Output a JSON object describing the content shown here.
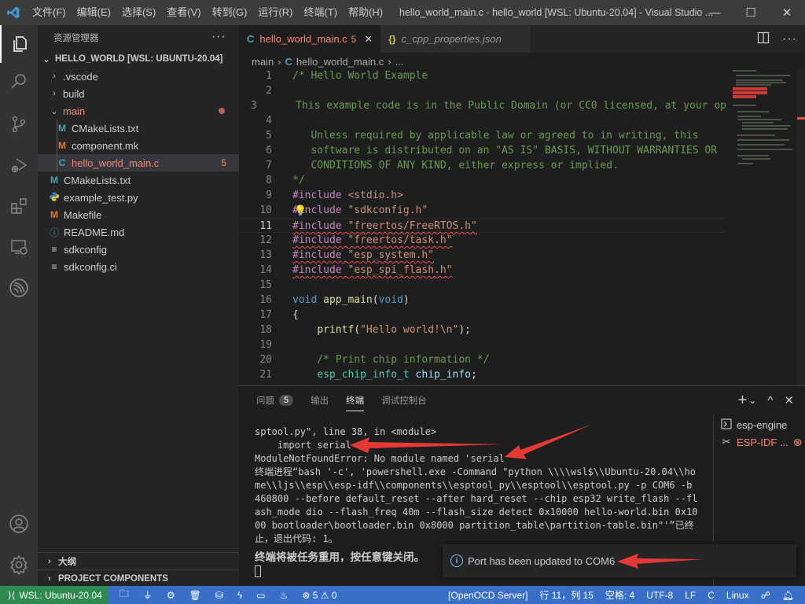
{
  "window": {
    "title": "hello_world_main.c - hello_world [WSL: Ubuntu-20.04] - Visual Studio ...",
    "menu": [
      "文件(F)",
      "编辑(E)",
      "选择(S)",
      "查看(V)",
      "转到(G)",
      "运行(R)",
      "终端(T)",
      "帮助(H)"
    ],
    "controls": {
      "minimize": "—",
      "maximize": "☐",
      "close": "✕"
    }
  },
  "activity_bar": {
    "items": [
      "explorer-icon",
      "search-icon",
      "source-control-icon",
      "run-debug-icon",
      "extensions-icon",
      "remote-explorer-icon",
      "espressif-icon"
    ],
    "bottom": [
      "account-icon",
      "settings-gear-icon"
    ]
  },
  "sidebar": {
    "title": "资源管理器",
    "more": "···",
    "root": "HELLO_WORLD [WSL: UBUNTU-20.04]",
    "tree": [
      {
        "label": ".vscode",
        "type": "folder",
        "expanded": false
      },
      {
        "label": "build",
        "type": "folder",
        "expanded": false
      },
      {
        "label": "main",
        "type": "folder",
        "expanded": true,
        "modified": true
      },
      {
        "label": "CMakeLists.txt",
        "icon": "M",
        "icon_color": "#519aba"
      },
      {
        "label": "component.mk",
        "icon": "M",
        "icon_color": "#e37933"
      },
      {
        "label": "hello_world_main.c",
        "icon": "C",
        "icon_color": "#519aba",
        "problems": "5"
      },
      {
        "label": "CMakeLists.txt",
        "icon": "M",
        "icon_color": "#519aba"
      },
      {
        "label": "example_test.py",
        "icon": "py",
        "icon_color": "#519aba"
      },
      {
        "label": "Makefile",
        "icon": "M",
        "icon_color": "#e37933"
      },
      {
        "label": "README.md",
        "icon": "ⓘ",
        "icon_color": "#519aba"
      },
      {
        "label": "sdkconfig",
        "icon": "≡",
        "icon_color": "#cccccc"
      },
      {
        "label": "sdkconfig.ci",
        "icon": "≡",
        "icon_color": "#cccccc"
      }
    ],
    "sections": [
      "大纲",
      "PROJECT COMPONENTS"
    ]
  },
  "editor": {
    "tabs": [
      {
        "icon": "C",
        "label": "hello_world_main.c",
        "problems": "5",
        "close": "✕",
        "active": true
      },
      {
        "icon": "{}",
        "label": "c_cpp_properties.json",
        "active": false
      }
    ],
    "breadcrumb": [
      "main",
      "hello_world_main.c",
      "..."
    ],
    "current_line": 11,
    "lines": [
      {
        "n": "1",
        "text": "/* Hello World Example"
      },
      {
        "n": "2",
        "text": ""
      },
      {
        "n": "3",
        "text": "   This example code is in the Public Domain (or CC0 licensed, at your op"
      },
      {
        "n": "4",
        "text": ""
      },
      {
        "n": "5",
        "text": "   Unless required by applicable law or agreed to in writing, this"
      },
      {
        "n": "6",
        "text": "   software is distributed on an \"AS IS\" BASIS, WITHOUT WARRANTIES OR"
      },
      {
        "n": "7",
        "text": "   CONDITIONS OF ANY KIND, either express or implied."
      },
      {
        "n": "8",
        "text": "*/"
      },
      {
        "n": "9",
        "pp": "#include",
        "arg": "<stdio.h>"
      },
      {
        "n": "10",
        "pp": "#include",
        "arg": "\"sdkconfig.h\""
      },
      {
        "n": "11",
        "pp": "#include",
        "arg": "\"freertos/FreeRTOS.h\""
      },
      {
        "n": "12",
        "pp": "#include",
        "arg": "\"freertos/task.h\""
      },
      {
        "n": "13",
        "pp": "#include",
        "arg": "\"esp_system.h\""
      },
      {
        "n": "14",
        "pp": "#include",
        "arg": "\"esp_spi_flash.h\""
      },
      {
        "n": "15",
        "text": ""
      },
      {
        "n": "16",
        "kw": "void",
        "fn": "app_main",
        "p1": "(",
        "kw2": "void",
        "p2": ")"
      },
      {
        "n": "17",
        "text": "{"
      },
      {
        "n": "18",
        "fn": "printf",
        "p1": "(",
        "str": "\"Hello world!\\n\"",
        "p2": ");"
      },
      {
        "n": "19",
        "text": ""
      },
      {
        "n": "20",
        "text": "    /* Print chip information */"
      },
      {
        "n": "21",
        "ty": "esp_chip_info_t",
        "var": "chip_info",
        "p2": ";"
      }
    ]
  },
  "panel": {
    "tabs": [
      {
        "label": "问题",
        "badge": "5"
      },
      {
        "label": "输出"
      },
      {
        "label": "终端",
        "active": true
      },
      {
        "label": "调试控制台"
      }
    ],
    "actions": {
      "new": "+",
      "dropdown": "⌄",
      "maximize": "^",
      "close": "✕"
    },
    "terminal_lines": [
      "sptool.py\", line 38, in <module>",
      "    import serial",
      "ModuleNotFoundError: No module named 'serial'",
      "终端进程“bash '-c', 'powershell.exe -Command \"python \\\\\\\\wsl$\\\\Ubuntu-20.04\\\\home\\\\ljs\\\\esp\\\\esp-idf\\\\components\\\\esptool_py\\\\esptool\\\\esptool.py -p COM6 -b 460800 --before default_reset --after hard_reset --chip esp32 write_flash --flash_mode dio --flash_freq 40m --flash_size detect 0x10000 hello-world.bin 0x1000 bootloader\\bootloader.bin 0x8000 partition_table\\partition-table.bin\"'”已终止，退出代码: 1。"
    ],
    "terminal_notice": "终端将被任务重用，按任意键关闭。",
    "terminals": [
      {
        "label": "esp-engine",
        "icon": "terminal-icon"
      },
      {
        "label": "ESP-IDF ...",
        "icon": "tools-icon",
        "error": true
      }
    ]
  },
  "notification": {
    "text": "Port has been updated to COM6",
    "icon": "info-icon"
  },
  "statusbar": {
    "remote": "WSL: Ubuntu-20.04",
    "icons": [
      "folder-icon",
      "plug-icon",
      "gear-icon",
      "trash-icon",
      "database-icon",
      "flash-icon",
      "monitor-icon",
      "flame-icon"
    ],
    "errors": "5",
    "warnings": "0",
    "openocd": "[OpenOCD Server]",
    "position": "行 11，列 15",
    "indent": "空格: 4",
    "encoding": "UTF-8",
    "eol": "LF",
    "language": "C",
    "platform": "Linux"
  },
  "colors": {
    "statusbar": "#3a6fc7",
    "remote": "#2f8a4f",
    "error_text": "#f48771",
    "accent_arrow": "#e53935"
  }
}
